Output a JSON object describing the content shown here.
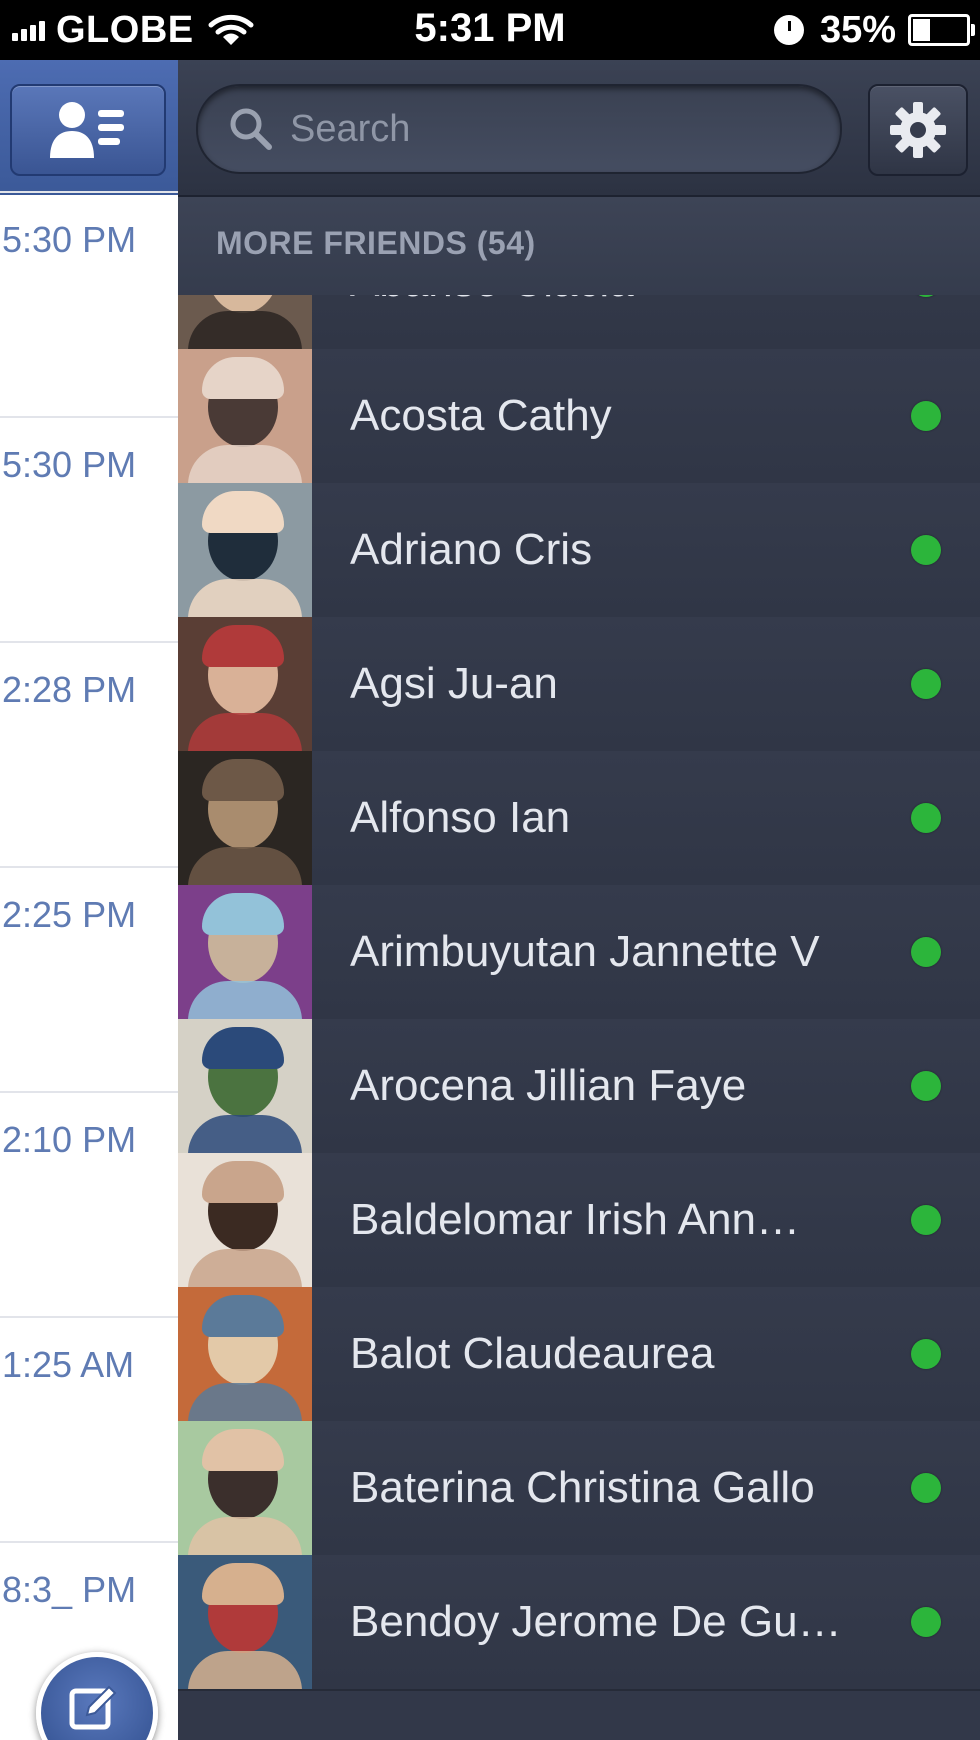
{
  "status_bar": {
    "carrier": "GLOBE",
    "time": "5:31 PM",
    "battery": "35%",
    "battery_level": 0.35
  },
  "messages": {
    "times": [
      "5:30 PM",
      "5:30 PM",
      "2:28 PM",
      "2:25 PM",
      "2:10 PM",
      "1:25 AM",
      "8:3_ PM"
    ]
  },
  "search": {
    "placeholder": "Search"
  },
  "section": {
    "title": "MORE FRIENDS (54)"
  },
  "friends": [
    {
      "name": "Abariso Clacla",
      "online": true
    },
    {
      "name": "Acosta Cathy",
      "online": true
    },
    {
      "name": "Adriano Cris",
      "online": true
    },
    {
      "name": "Agsi Ju-an",
      "online": true
    },
    {
      "name": "Alfonso Ian",
      "online": true
    },
    {
      "name": "Arimbuyutan Jannette V",
      "online": true
    },
    {
      "name": "Arocena Jillian Faye",
      "online": true
    },
    {
      "name": "Baldelomar Irish Ann…",
      "online": true
    },
    {
      "name": "Balot Claudeaurea",
      "online": true
    },
    {
      "name": "Baterina Christina Gallo",
      "online": true
    },
    {
      "name": "Bendoy Jerome De Gu…",
      "online": true
    }
  ],
  "colors": {
    "accent": "#3b5998",
    "online": "#2cb53b",
    "panel": "#323849"
  },
  "icons": {
    "friends": "friends-list-icon",
    "search": "search-icon",
    "settings": "gear-icon",
    "compose": "compose-icon"
  }
}
